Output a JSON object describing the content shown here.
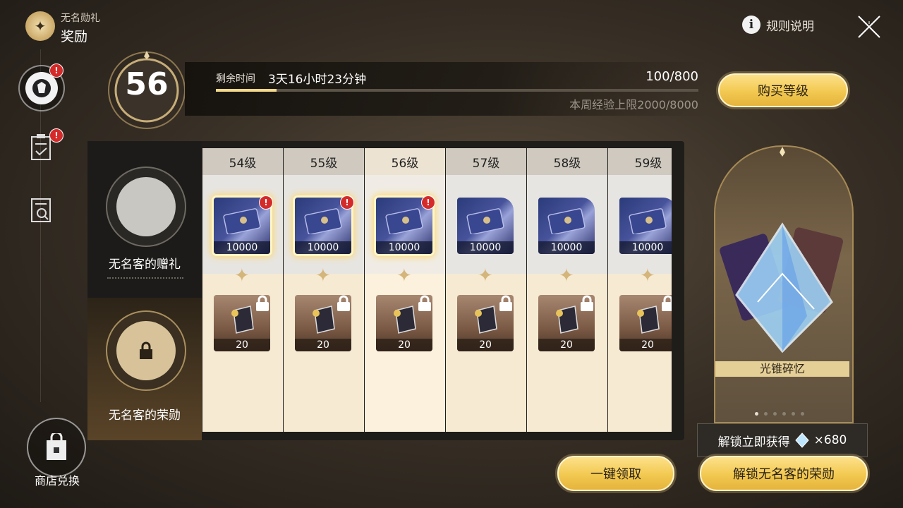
{
  "header": {
    "subtitle": "无名勋礼",
    "title": "奖励",
    "rules_label": "规则说明"
  },
  "level": {
    "current": "56",
    "time_label": "剩余时间",
    "time_value": "3天16小时23分钟",
    "exp": "100/800",
    "exp_fraction": 0.125,
    "week_cap": "本周经验上限2000/8000"
  },
  "buy_button": "购买等级",
  "tracks": {
    "free_label": "无名客的赠礼",
    "paid_label": "无名客的荣勋"
  },
  "columns": [
    {
      "level": "54级",
      "free_qty": "10000",
      "paid_qty": "20",
      "claimable": true
    },
    {
      "level": "55级",
      "free_qty": "10000",
      "paid_qty": "20",
      "claimable": true
    },
    {
      "level": "56级",
      "free_qty": "10000",
      "paid_qty": "20",
      "claimable": true
    },
    {
      "level": "57级",
      "free_qty": "10000",
      "paid_qty": "20",
      "claimable": false
    },
    {
      "level": "58级",
      "free_qty": "10000",
      "paid_qty": "20",
      "claimable": false
    },
    {
      "level": "59级",
      "free_qty": "10000",
      "paid_qty": "20",
      "claimable": false
    }
  ],
  "featured": {
    "label": "光锥碎忆",
    "page_count": 6,
    "page_index": 0
  },
  "tooltip": {
    "text": "解锁立即获得",
    "amount": "×680"
  },
  "buttons": {
    "claim_all": "一键领取",
    "unlock": "解锁无名客的荣勋"
  },
  "shop": {
    "label": "商店兑换"
  },
  "colors": {
    "gold": "#f2c850",
    "alert": "#d42a2a",
    "panel": "#1f1d1a"
  }
}
